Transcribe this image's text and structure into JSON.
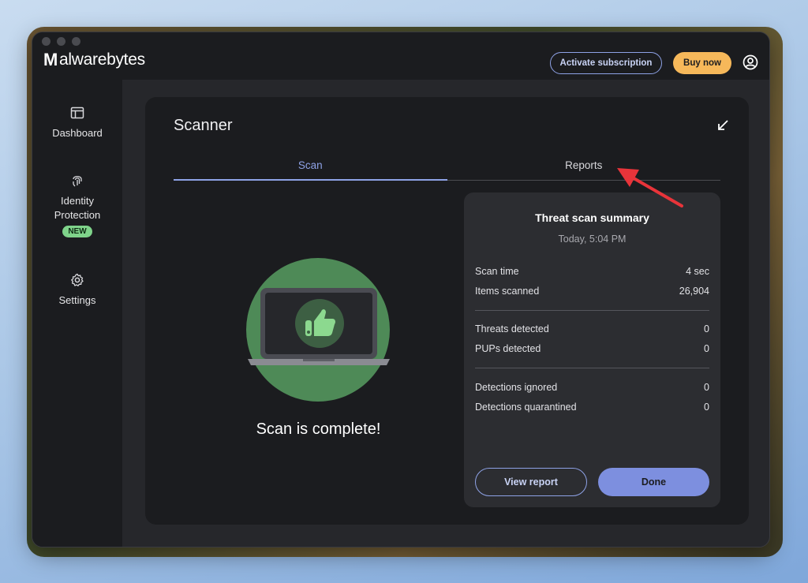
{
  "app": {
    "brand_mark": "M",
    "brand_word": "alwarebytes"
  },
  "header": {
    "activate_label": "Activate subscription",
    "buy_label": "Buy now",
    "account_icon": "account-circle-icon"
  },
  "sidebar": {
    "items": [
      {
        "label": "Dashboard",
        "icon": "dashboard-icon"
      },
      {
        "label": "Identity\nProtection",
        "label_line1": "Identity",
        "label_line2": "Protection",
        "badge": "NEW",
        "icon": "fingerprint-icon"
      },
      {
        "label": "Settings",
        "icon": "gear-icon"
      }
    ]
  },
  "scanner": {
    "title": "Scanner",
    "tabs": [
      {
        "label": "Scan",
        "active": true
      },
      {
        "label": "Reports",
        "active": false
      }
    ],
    "status_text": "Scan is complete!"
  },
  "summary": {
    "title": "Threat scan summary",
    "date": "Today, 5:04 PM",
    "rows": [
      {
        "label": "Scan time",
        "value": "4 sec"
      },
      {
        "label": "Items scanned",
        "value": "26,904"
      },
      {
        "label": "Threats detected",
        "value": "0"
      },
      {
        "label": "PUPs detected",
        "value": "0"
      },
      {
        "label": "Detections ignored",
        "value": "0"
      },
      {
        "label": "Detections quarantined",
        "value": "0"
      }
    ],
    "view_report_label": "View report",
    "done_label": "Done"
  },
  "colors": {
    "accent": "#8ea2e6",
    "buy": "#f6b85a",
    "success": "#4e8a57",
    "annotation": "#e8343a"
  }
}
